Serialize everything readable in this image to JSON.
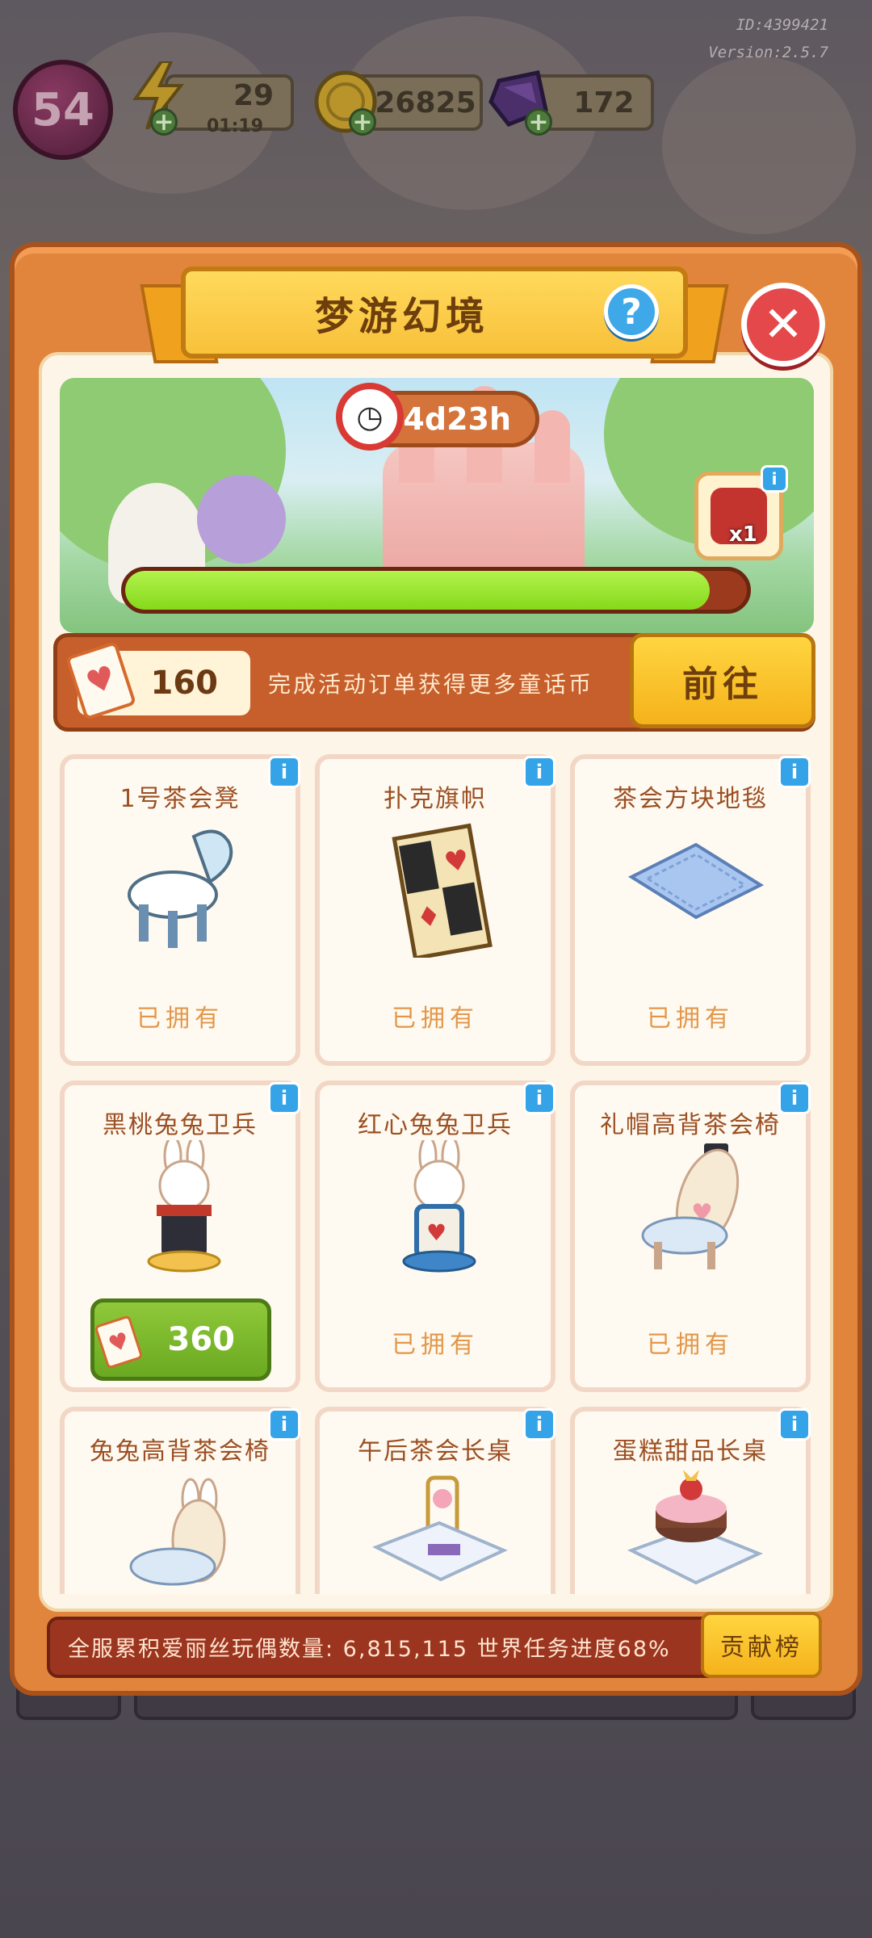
{
  "hud": {
    "level": "54",
    "energy": "29",
    "energy_timer": "01:19",
    "coins": "26825",
    "gems": "172",
    "player_id": "ID:4399421",
    "version": "Version:2.5.7"
  },
  "event": {
    "title": "梦游幻境",
    "countdown": "4d23h",
    "progress_percent": 94,
    "reward_quantity": "x1",
    "coin_amount": "160",
    "coin_hint": "完成活动订单获得更多童话币",
    "goto_label": "前往"
  },
  "items": [
    {
      "name": "1号茶会凳",
      "status": "已拥有",
      "art_icon": "chair-icon"
    },
    {
      "name": "扑克旗帜",
      "status": "已拥有",
      "art_icon": "flag-icon"
    },
    {
      "name": "茶会方块地毯",
      "status": "已拥有",
      "art_icon": "rug-icon"
    },
    {
      "name": "黑桃兔兔卫兵",
      "price": "360",
      "art_icon": "rabbit-guard-icon"
    },
    {
      "name": "红心兔兔卫兵",
      "status": "已拥有",
      "art_icon": "rabbit-guard-icon"
    },
    {
      "name": "礼帽高背茶会椅",
      "status": "已拥有",
      "art_icon": "chair-icon"
    },
    {
      "name": "兔兔高背茶会椅",
      "art_icon": "chair-icon"
    },
    {
      "name": "午后茶会长桌",
      "art_icon": "table-icon"
    },
    {
      "name": "蛋糕甜品长桌",
      "art_icon": "cake-table-icon"
    }
  ],
  "footer": {
    "stats_text": "全服累积爱丽丝玩偶数量: 6,815,115  世界任务进度68%",
    "rank_label": "贡献榜"
  },
  "colors": {
    "panel_orange": "#e2853c",
    "ribbon_yellow": "#f8c13a",
    "progress_green": "#86d91b",
    "price_green": "#6aa921",
    "close_red": "#e5484a",
    "info_blue": "#34a3e8"
  }
}
